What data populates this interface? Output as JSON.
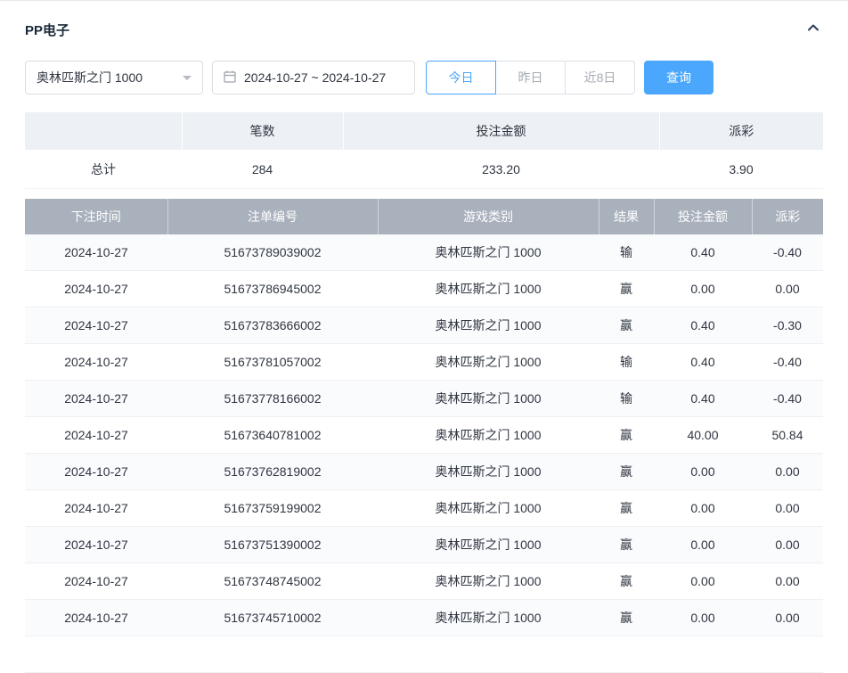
{
  "panel": {
    "title": "PP电子"
  },
  "icons": {
    "collapse": "chevron-up-icon",
    "calendar": "calendar-icon",
    "select_caret": "caret-down-icon"
  },
  "filters": {
    "game_select": {
      "value": "奥林匹斯之门 1000"
    },
    "date_range": {
      "value": "2024-10-27 ~ 2024-10-27"
    },
    "quick_buttons": [
      {
        "label": "今日",
        "active": true
      },
      {
        "label": "昨日",
        "active": false
      },
      {
        "label": "近8日",
        "active": false
      }
    ],
    "query_button": "查询"
  },
  "summary_table": {
    "headers": [
      "笔数",
      "投注金额",
      "派彩"
    ],
    "total_label": "总计",
    "total": {
      "count": "284",
      "bet_amount": "233.20",
      "payout": "3.90"
    }
  },
  "detail_table": {
    "headers": [
      "下注时间",
      "注单编号",
      "游戏类别",
      "结果",
      "投注金额",
      "派彩"
    ],
    "rows": [
      [
        "2024-10-27",
        "51673789039002",
        "奥林匹斯之门 1000",
        "输",
        "0.40",
        "-0.40"
      ],
      [
        "2024-10-27",
        "51673786945002",
        "奥林匹斯之门 1000",
        "赢",
        "0.00",
        "0.00"
      ],
      [
        "2024-10-27",
        "51673783666002",
        "奥林匹斯之门 1000",
        "赢",
        "0.40",
        "-0.30"
      ],
      [
        "2024-10-27",
        "51673781057002",
        "奥林匹斯之门 1000",
        "输",
        "0.40",
        "-0.40"
      ],
      [
        "2024-10-27",
        "51673778166002",
        "奥林匹斯之门 1000",
        "输",
        "0.40",
        "-0.40"
      ],
      [
        "2024-10-27",
        "51673640781002",
        "奥林匹斯之门 1000",
        "赢",
        "40.00",
        "50.84"
      ],
      [
        "2024-10-27",
        "51673762819002",
        "奥林匹斯之门 1000",
        "赢",
        "0.00",
        "0.00"
      ],
      [
        "2024-10-27",
        "51673759199002",
        "奥林匹斯之门 1000",
        "赢",
        "0.00",
        "0.00"
      ],
      [
        "2024-10-27",
        "51673751390002",
        "奥林匹斯之门 1000",
        "赢",
        "0.00",
        "0.00"
      ],
      [
        "2024-10-27",
        "51673748745002",
        "奥林匹斯之门 1000",
        "赢",
        "0.00",
        "0.00"
      ],
      [
        "2024-10-27",
        "51673745710002",
        "奥林匹斯之门 1000",
        "赢",
        "0.00",
        "0.00"
      ]
    ]
  },
  "colors": {
    "accent_blue": "#4ba7fb",
    "negative_red": "#f56c6c",
    "table_header_gray": "#a9b1bd",
    "summary_header_gray": "#edf0f4"
  }
}
